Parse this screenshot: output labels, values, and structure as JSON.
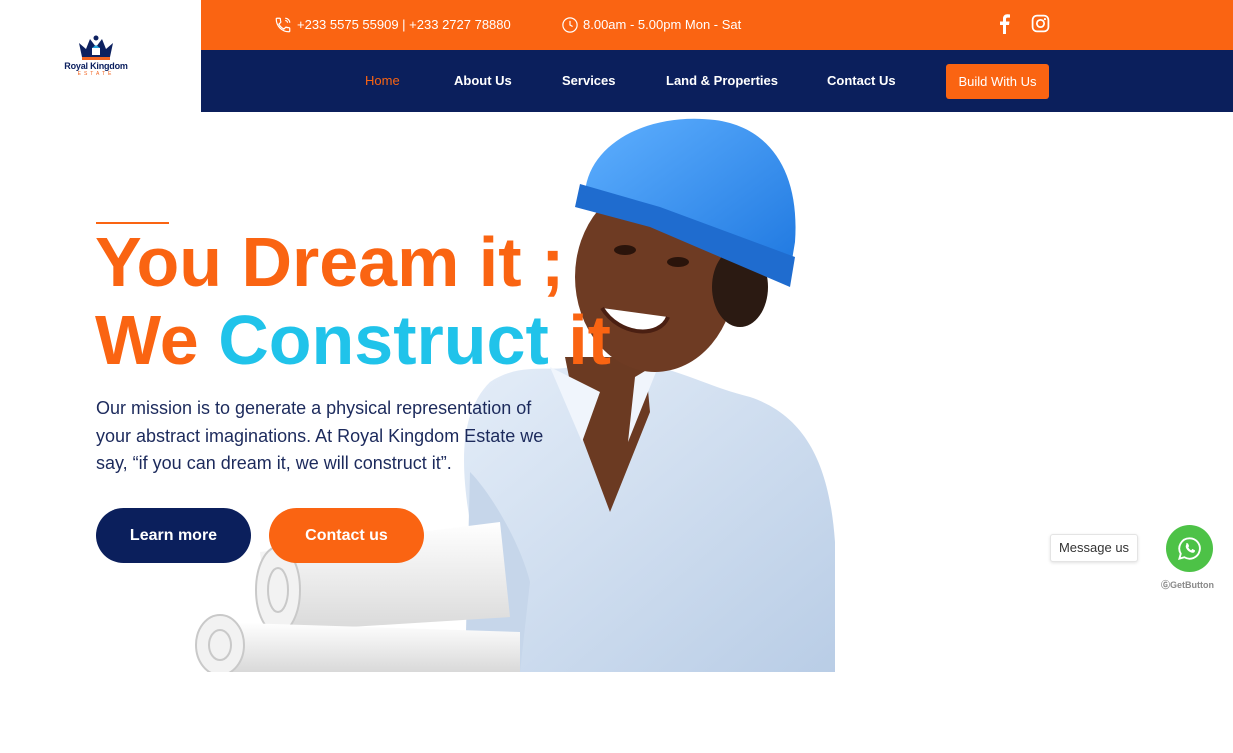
{
  "brand": {
    "name": "Royal Kingdom",
    "tagline": "ESTATE"
  },
  "topbar": {
    "phone": "+233 5575 55909 | +233 2727 78880",
    "hours": "8.00am - 5.00pm Mon - Sat",
    "social": [
      "facebook-icon",
      "instagram-icon"
    ]
  },
  "nav": {
    "items": [
      {
        "label": "Home",
        "active": true
      },
      {
        "label": "About Us"
      },
      {
        "label": "Services"
      },
      {
        "label": "Land & Properties"
      },
      {
        "label": "Contact Us"
      }
    ],
    "cta": "Build With Us"
  },
  "hero": {
    "line1": "You Dream it ;",
    "line2_a": "We",
    "line2_b": "Construct",
    "line2_c": "it",
    "description": "Our mission is to generate a physical representation of your abstract imaginations. At Royal Kingdom Estate we say, “if you can dream it, we will construct it”.",
    "learn_more": "Learn more",
    "contact_us": "Contact us"
  },
  "whatsapp": {
    "message": "Message us",
    "powered_by": "GetButton"
  },
  "colors": {
    "accent": "#fa6412",
    "navy": "#0b1f5c",
    "cyan": "#20c3ea",
    "whatsapp": "#4dc247"
  }
}
